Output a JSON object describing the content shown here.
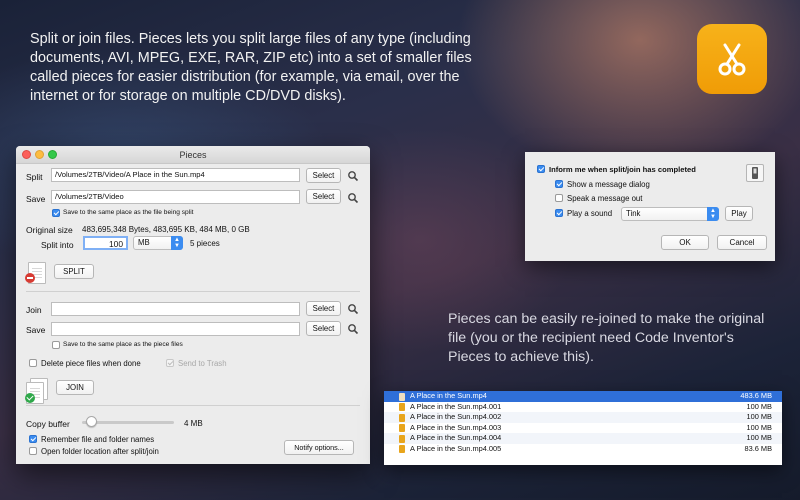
{
  "promo": {
    "top_text": "Split or join files. Pieces lets you split large files of any type (including documents, AVI, MPEG, EXE, RAR, ZIP etc) into a set of smaller files called pieces for easier distribution (for example, via email, over the internet or for storage on multiple CD/DVD disks).",
    "mid_text": "Pieces can be easily re-joined to make the original file (you or the recipient need Code Inventor's Pieces to achieve this)."
  },
  "app_icon": {
    "name": "scissors-icon",
    "color": "#F5A714"
  },
  "window": {
    "title": "Pieces",
    "split": {
      "split_label": "Split",
      "split_value": "/Volumes/2TB/Video/A Place in the Sun.mp4",
      "save_label": "Save",
      "save_value": "/Volumes/2TB/Video",
      "select_label": "Select",
      "same_place_label": "Save to the same place as the file being split",
      "original_size_label": "Original size",
      "original_size_value": "483,695,348 Bytes, 483,695 KB, 484 MB, 0 GB",
      "split_into_label": "Split into",
      "split_into_value": "100",
      "unit_value": "MB",
      "pieces_count": "5 pieces",
      "split_button": "SPLIT"
    },
    "join": {
      "join_label": "Join",
      "join_value": "",
      "save_label": "Save",
      "save_value": "",
      "select_label": "Select",
      "same_place_label": "Save to the same place as the piece files",
      "delete_label": "Delete piece files when done",
      "trash_label": "Send to Trash",
      "join_button": "JOIN"
    },
    "bottom": {
      "copy_buffer_label": "Copy buffer",
      "copy_buffer_value": "4 MB",
      "copy_buffer_level": 0.05,
      "remember_label": "Remember file and folder names",
      "open_folder_label": "Open folder location after split/join",
      "notify_button": "Notify options..."
    }
  },
  "notify_panel": {
    "inform_label": "Inform me when split/join has completed",
    "show_dialog_label": "Show a message dialog",
    "speak_label": "Speak a message out",
    "play_sound_label": "Play a sound",
    "sound_value": "Tink",
    "play_button": "Play",
    "ok_button": "OK",
    "cancel_button": "Cancel"
  },
  "file_list": [
    {
      "name": "A Place in the Sun.mp4",
      "size": "483.6 MB",
      "selected": true
    },
    {
      "name": "A Place in the Sun.mp4.001",
      "size": "100 MB",
      "selected": false
    },
    {
      "name": "A Place in the Sun.mp4.002",
      "size": "100 MB",
      "selected": false
    },
    {
      "name": "A Place in the Sun.mp4.003",
      "size": "100 MB",
      "selected": false
    },
    {
      "name": "A Place in the Sun.mp4.004",
      "size": "100 MB",
      "selected": false
    },
    {
      "name": "A Place in the Sun.mp4.005",
      "size": "83.6 MB",
      "selected": false
    }
  ],
  "colors": {
    "accent": "#3B8CF0",
    "selection": "#2F6FD8",
    "app_icon": "#F5A714"
  }
}
